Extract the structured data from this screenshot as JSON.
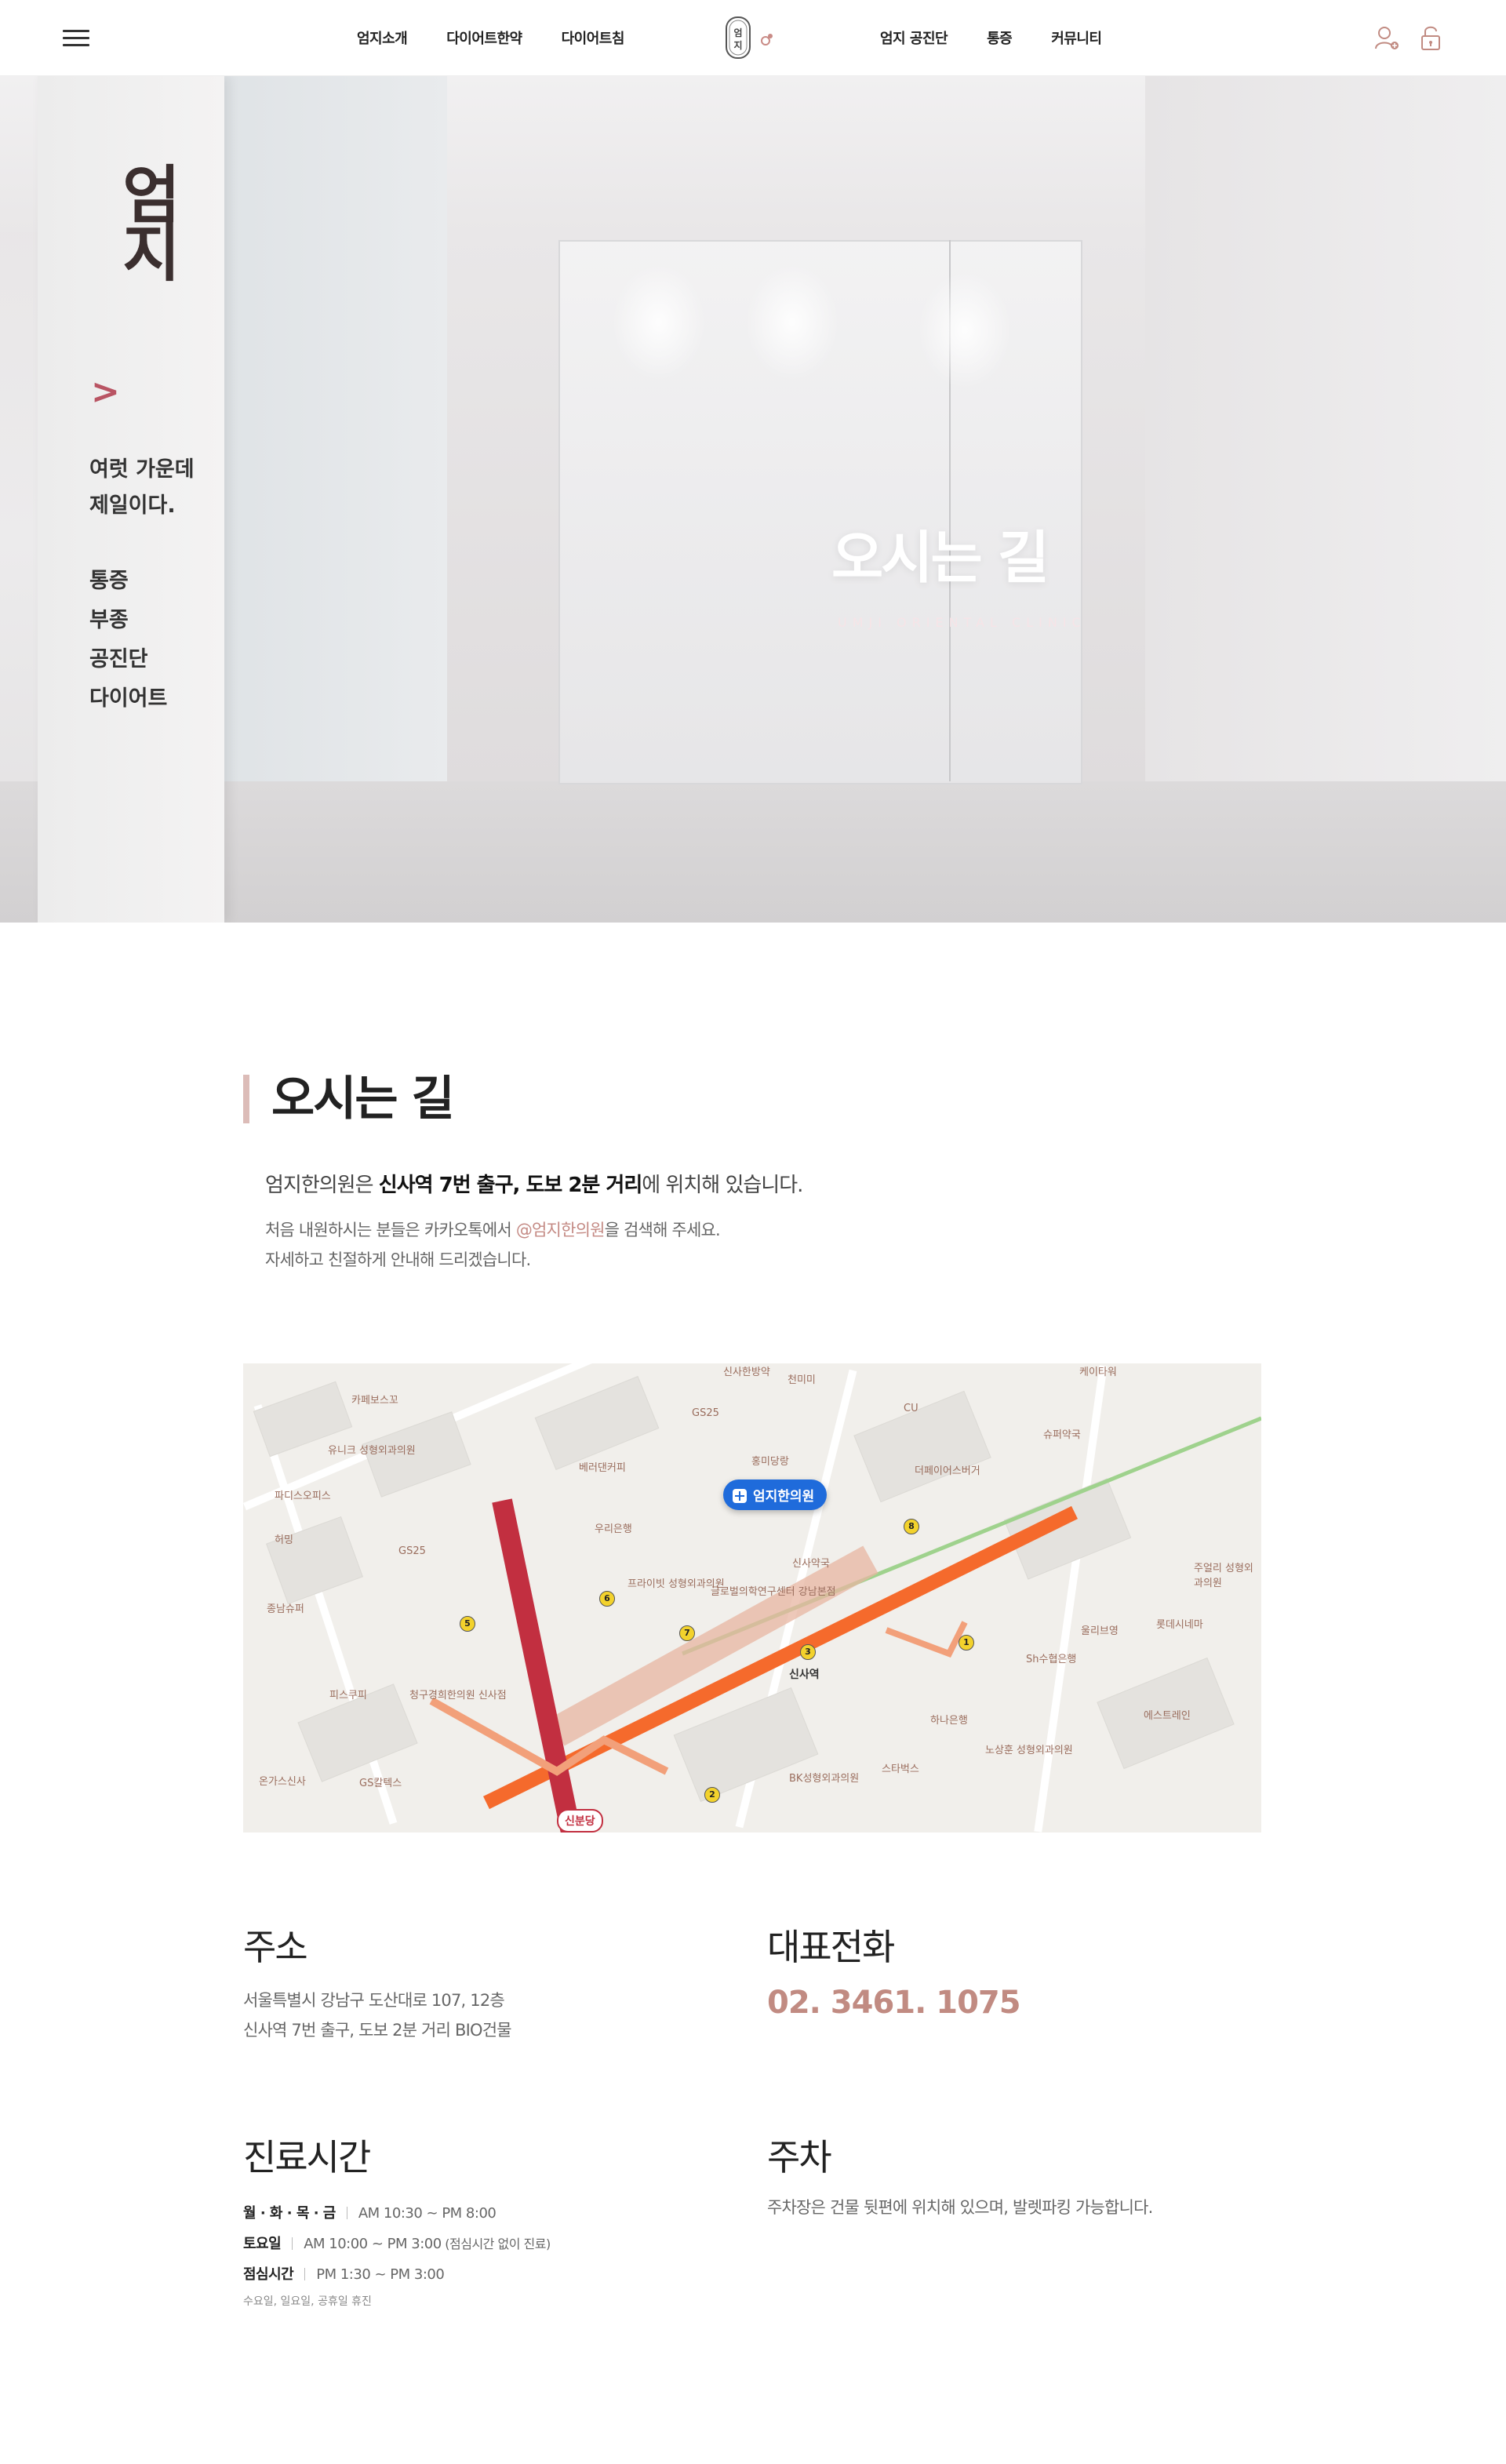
{
  "header": {
    "nav_left": [
      "엄지소개",
      "다이어트한약",
      "다이어트침"
    ],
    "nav_right": [
      "엄지 공진단",
      "통증",
      "커뮤니티"
    ]
  },
  "hero": {
    "panel_brand": "엄지",
    "panel_copy_1": "여럿 가운데",
    "panel_copy_2": "제일이다.",
    "panel_list": [
      "통증",
      "부종",
      "공진단",
      "다이어트"
    ],
    "title": "오시는 길",
    "subtitle": "UMJI ORIENTAL CLINIC"
  },
  "location": {
    "title": "오시는 길",
    "intro_prefix": "엄지한의원은 ",
    "intro_bold": "신사역 7번 출구, 도보 2분 거리",
    "intro_suffix": "에 위치해 있습니다.",
    "note_line1_prefix": "처음 내원하시는 분들은 카카오톡에서 ",
    "note_line1_highlight": "@엄지한의원",
    "note_line1_suffix": "을 검색해 주세요.",
    "note_line2": "자세하고 친절하게 안내해 드리겠습니다."
  },
  "map": {
    "marker_label": "엄지한의원",
    "station_label": "신사역",
    "sinbundang_label": "신분당",
    "pois": [
      "카페보스꼬",
      "유니크 성형외과의원",
      "파디스오피스",
      "허밍",
      "GS25",
      "종남슈퍼",
      "피스쿠피",
      "청구경희한의원 신사점",
      "GS칼텍스",
      "온가스신사",
      "베러댄커피",
      "우리은행",
      "GS25",
      "프라이빗 성형외과의원",
      "글로벌의학연구센터 강남본점",
      "CU",
      "더페이어스버거",
      "슈퍼약국",
      "케이타워",
      "홍미당랑",
      "신사약국",
      "하나은행",
      "Sh수협은행",
      "울리브영",
      "롯데시네마",
      "주얼리 성형외과의원",
      "에스트레인",
      "BK성형외과의원",
      "스타벅스",
      "노상훈 성형외과의원",
      "천미미",
      "신사한방약"
    ],
    "exits": [
      "1",
      "2",
      "3",
      "5",
      "6",
      "7",
      "8"
    ]
  },
  "address": {
    "title": "주소",
    "line1": "서울특별시 강남구 도산대로 107, 12층",
    "line2": "신사역 7번 출구, 도보 2분 거리 BIO건물"
  },
  "phone": {
    "title": "대표전화",
    "number": "02. 3461. 1075"
  },
  "hours": {
    "title": "진료시간",
    "rows": [
      {
        "day": "월 · 화 · 목 · 금",
        "time": "AM 10:30 ~ PM 8:00",
        "extra": ""
      },
      {
        "day": "토요일",
        "time": "AM 10:00 ~ PM 3:00",
        "extra": " (점심시간 없이 진료)"
      },
      {
        "day": "점심시간",
        "time": "PM 1:30 ~ PM 3:00",
        "extra": ""
      }
    ],
    "closed": "수요일, 일요일, 공휴일 휴진"
  },
  "parking": {
    "title": "주차",
    "text": "주차장은 건물 뒷편에 위치해 있으며, 발렛파킹 가능합니다."
  },
  "colors": {
    "accent": "#c18b82",
    "title_bar": "#dcbcb8",
    "map_marker": "#1f6bdb",
    "subway_line": "#f56a2c",
    "sinbundang_line": "#c22f40"
  },
  "icons": [
    "menu-icon",
    "logo",
    "user-icon",
    "lock-icon",
    "map-marker-icon"
  ]
}
